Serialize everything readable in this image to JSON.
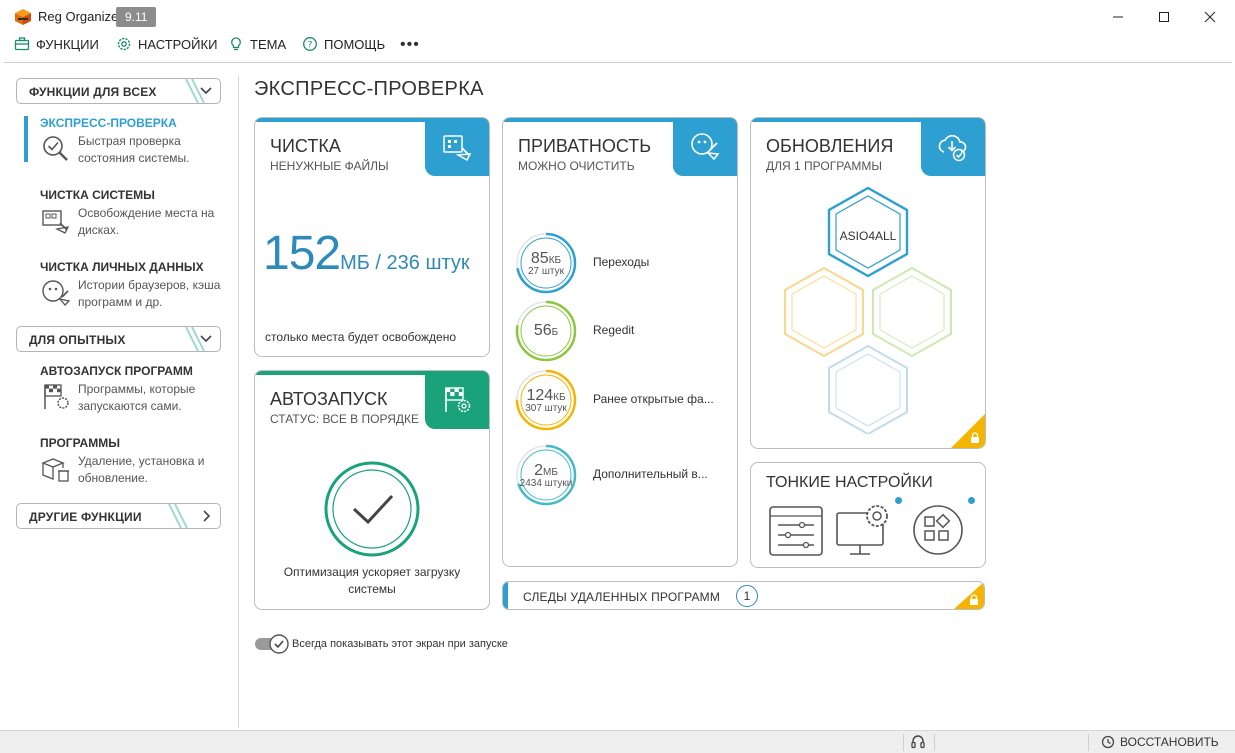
{
  "window": {
    "title": "Reg Organizer",
    "version": "9.11"
  },
  "menu": {
    "functions": "ФУНКЦИИ",
    "settings": "НАСТРОЙКИ",
    "theme": "ТЕМА",
    "help": "ПОМОЩЬ",
    "more": "•••"
  },
  "sidebar": {
    "group_all": "ФУНКЦИИ ДЛЯ ВСЕХ",
    "group_advanced": "ДЛЯ ОПЫТНЫХ",
    "group_other": "ДРУГИЕ ФУНКЦИИ",
    "items": [
      {
        "title": "ЭКСПРЕСС-ПРОВЕРКА",
        "desc": "Быстрая проверка состояния системы."
      },
      {
        "title": "ЧИСТКА СИСТЕМЫ",
        "desc": "Освобождение места на дисках."
      },
      {
        "title": "ЧИСТКА ЛИЧНЫХ ДАННЫХ",
        "desc": "Истории браузеров, кэша программ и др."
      },
      {
        "title": "АВТОЗАПУСК ПРОГРАММ",
        "desc": "Программы, которые запускаются сами."
      },
      {
        "title": "ПРОГРАММЫ",
        "desc": "Удаление, установка и обновление."
      }
    ]
  },
  "main": {
    "title": "ЭКСПРЕСС-ПРОВЕРКА",
    "cleanup": {
      "title": "ЧИСТКА",
      "subtitle": "НЕНУЖНЫЕ ФАЙЛЫ",
      "size": "152",
      "unit_count": "МБ / 236 штук",
      "footer": "столько места будет освобождено"
    },
    "autorun": {
      "title": "АВТОЗАПУСК",
      "subtitle": "СТАТУС: ВСЕ В ПОРЯДКЕ",
      "footer_line1": "Оптимизация ускоряет загрузку",
      "footer_line2": "системы"
    },
    "privacy": {
      "title": "ПРИВАТНОСТЬ",
      "subtitle": "МОЖНО ОЧИСТИТЬ",
      "rows": [
        {
          "value": "85",
          "unit": "КБ",
          "count": "27 штук",
          "label": "Переходы",
          "color": "#2e9fd1",
          "fraction": 0.72
        },
        {
          "value": "56",
          "unit": "Б",
          "count": "",
          "label": "Regedit",
          "color": "#8cc63f",
          "fraction": 0.78
        },
        {
          "value": "124",
          "unit": "КБ",
          "count": "307 штук",
          "label": "Ранее открытые фа...",
          "color": "#f5b400",
          "fraction": 0.75
        },
        {
          "value": "2",
          "unit": "МБ",
          "count": "2434 штуки",
          "label": "Дополнительный в...",
          "color": "#46b9c8",
          "fraction": 0.7
        }
      ]
    },
    "updates": {
      "title": "ОБНОВЛЕНИЯ",
      "subtitle": "ДЛЯ 1 ПРОГРАММЫ",
      "program": "ASIO4ALL"
    },
    "tweaks": {
      "title": "ТОНКИЕ НАСТРОЙКИ"
    },
    "leftovers": {
      "label": "СЛЕДЫ УДАЛЕННЫХ ПРОГРАММ",
      "count": "1"
    },
    "show_on_start": "Всегда показывать этот экран при запуске"
  },
  "statusbar": {
    "restore": "ВОССТАНОВИТЬ"
  },
  "colors": {
    "accent_blue": "#2e9fd1",
    "accent_green": "#1aa37a",
    "lock_yellow": "#f5b400"
  }
}
